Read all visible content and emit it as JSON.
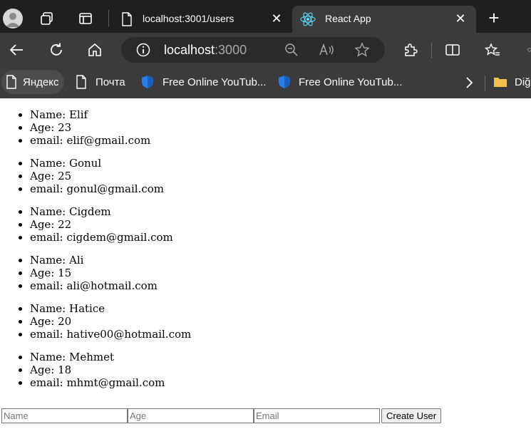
{
  "browser": {
    "tabs": [
      {
        "label": "localhost:3001/users",
        "active": false
      },
      {
        "label": "React App",
        "active": true
      }
    ],
    "new_tab": "+",
    "address": {
      "host": "localhost",
      "port": ":3000"
    },
    "bookmarks": [
      {
        "label": "Яндекс",
        "icon": "page-icon"
      },
      {
        "label": "Почта",
        "icon": "page-icon"
      },
      {
        "label": "Free Online YouTub...",
        "icon": "shield-icon"
      },
      {
        "label": "Free Online YouTub...",
        "icon": "shield-icon"
      }
    ],
    "bookmarks_overflow": "Diğ",
    "colors": {
      "dark_frame": "#1f1f1f",
      "toolbar": "#3b3b3b",
      "react": "#61dafb",
      "shield": "#2b7de9",
      "folder": "#f2c04b"
    }
  },
  "users": [
    {
      "name": "Name: Elif",
      "age": "Age: 23",
      "email": "email: elif@gmail.com"
    },
    {
      "name": "Name: Gonul",
      "age": "Age: 25",
      "email": "email: gonul@gmail.com"
    },
    {
      "name": "Name: Cigdem",
      "age": "Age: 22",
      "email": "email: cigdem@gmail.com"
    },
    {
      "name": "Name: Ali",
      "age": "Age: 15",
      "email": "email: ali@hotmail.com"
    },
    {
      "name": "Name: Hatice",
      "age": "Age: 20",
      "email": "email: hative00@hotmail.com"
    },
    {
      "name": "Name: Mehmet",
      "age": "Age: 18",
      "email": "email: mhmt@gmail.com"
    }
  ],
  "form": {
    "name_placeholder": "Name",
    "age_placeholder": "Age",
    "email_placeholder": "Email",
    "submit_label": "Create User"
  }
}
